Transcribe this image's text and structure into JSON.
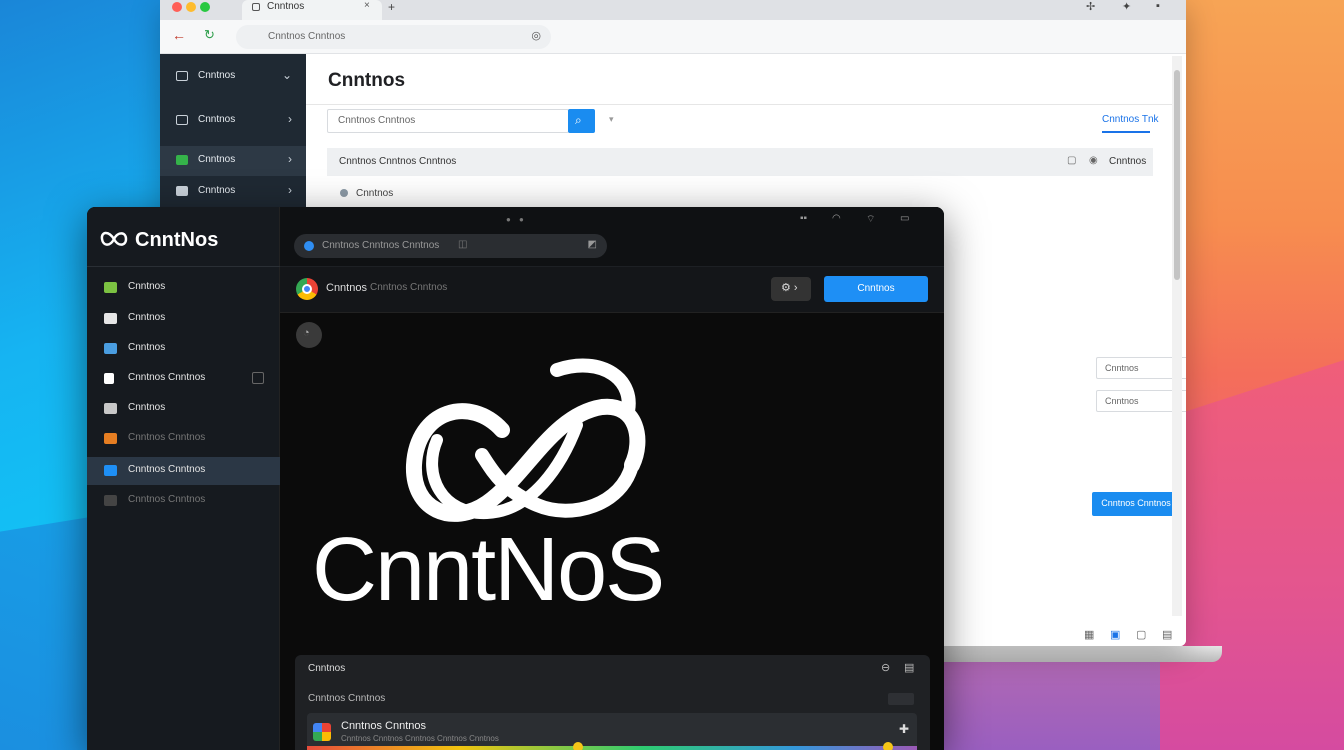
{
  "browser": {
    "tab_label": "Cnntnos",
    "url": "Cnntnos Cnntnos",
    "sidebar": [
      {
        "label": "Cnntnos",
        "icon": "dashboard-icon"
      },
      {
        "label": "Cnntnos",
        "icon": "window-icon"
      },
      {
        "label": "Cnntnos",
        "icon": "app-icon",
        "accent": "#35b34a"
      },
      {
        "label": "Cnntnos",
        "icon": "bag-icon"
      }
    ],
    "title": "Cnntnos",
    "search_placeholder": "Cnntnos Cnntnos",
    "tabs": "Cnntnos  Tnk",
    "table_header": "Cnntnos Cnntnos Cnntnos",
    "table_header_right": "Cnntnos",
    "row_label": "Cnntnos",
    "field1": "Cnntnos",
    "field2": "Cnntnos",
    "submit_label": "Cnntnos Cnntnos"
  },
  "app": {
    "brand": "CnntNos",
    "url": "Cnntnos Cnntnos Cnntnos",
    "sidebar": [
      {
        "label": "Cnntnos",
        "icon_color": "#7cc242"
      },
      {
        "label": "Cnntnos",
        "icon_color": "#e6e6e6"
      },
      {
        "label": "Cnntnos",
        "icon_color": "#4a9de0"
      },
      {
        "label": "Cnntnos Cnntnos",
        "icon_color": "#ffffff"
      },
      {
        "label": "Cnntnos",
        "icon_color": "#c8c8c8"
      },
      {
        "label": "Cnntnos Cnntnos",
        "icon_color": "#e67e22"
      },
      {
        "label": "Cnntnos Cnntnos",
        "icon_color": "#1e8ff5",
        "active": true
      },
      {
        "label": "Cnntnos Cnntnos",
        "icon_color": "#444444"
      }
    ],
    "toolbar_name": "Cnntnos",
    "toolbar_sub": "Cnntnos Cnntnos",
    "primary_button": "Cnntnos",
    "logo_text": "CnntNoS",
    "panel_title": "Cnntnos",
    "panel_subtitle": "Cnntnos Cnntnos",
    "row_title": "Cnntnos Cnntnos",
    "row_subtitle": "Cnntnos Cnntnos Cnntnos Cnntnos Cnntnos"
  }
}
